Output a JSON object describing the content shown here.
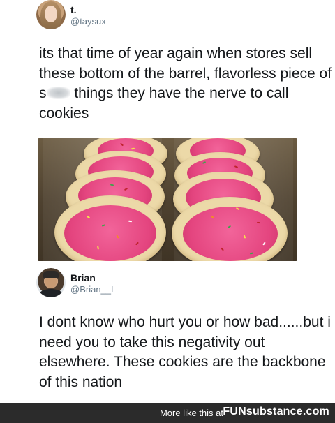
{
  "tweet1": {
    "name": "t.",
    "handle": "@taysux",
    "text_before": "its that time of year again when stores sell these bottom of the barrel, flavorless piece of s",
    "text_after": " things they have the nerve to call cookies"
  },
  "tweet2": {
    "name": "Brian",
    "handle": "@Brian__L",
    "text": "I dont know who hurt you or how bad......but i need you to take this negativity out elsewhere. These cookies are the backbone of this nation"
  },
  "footer": {
    "more_text": "More like this at",
    "brand": "FUNsubstance.com"
  },
  "colors": {
    "frosting": "#e4457f",
    "cookie": "#ecd9a8",
    "footer_bg": "#2b2b2b"
  }
}
